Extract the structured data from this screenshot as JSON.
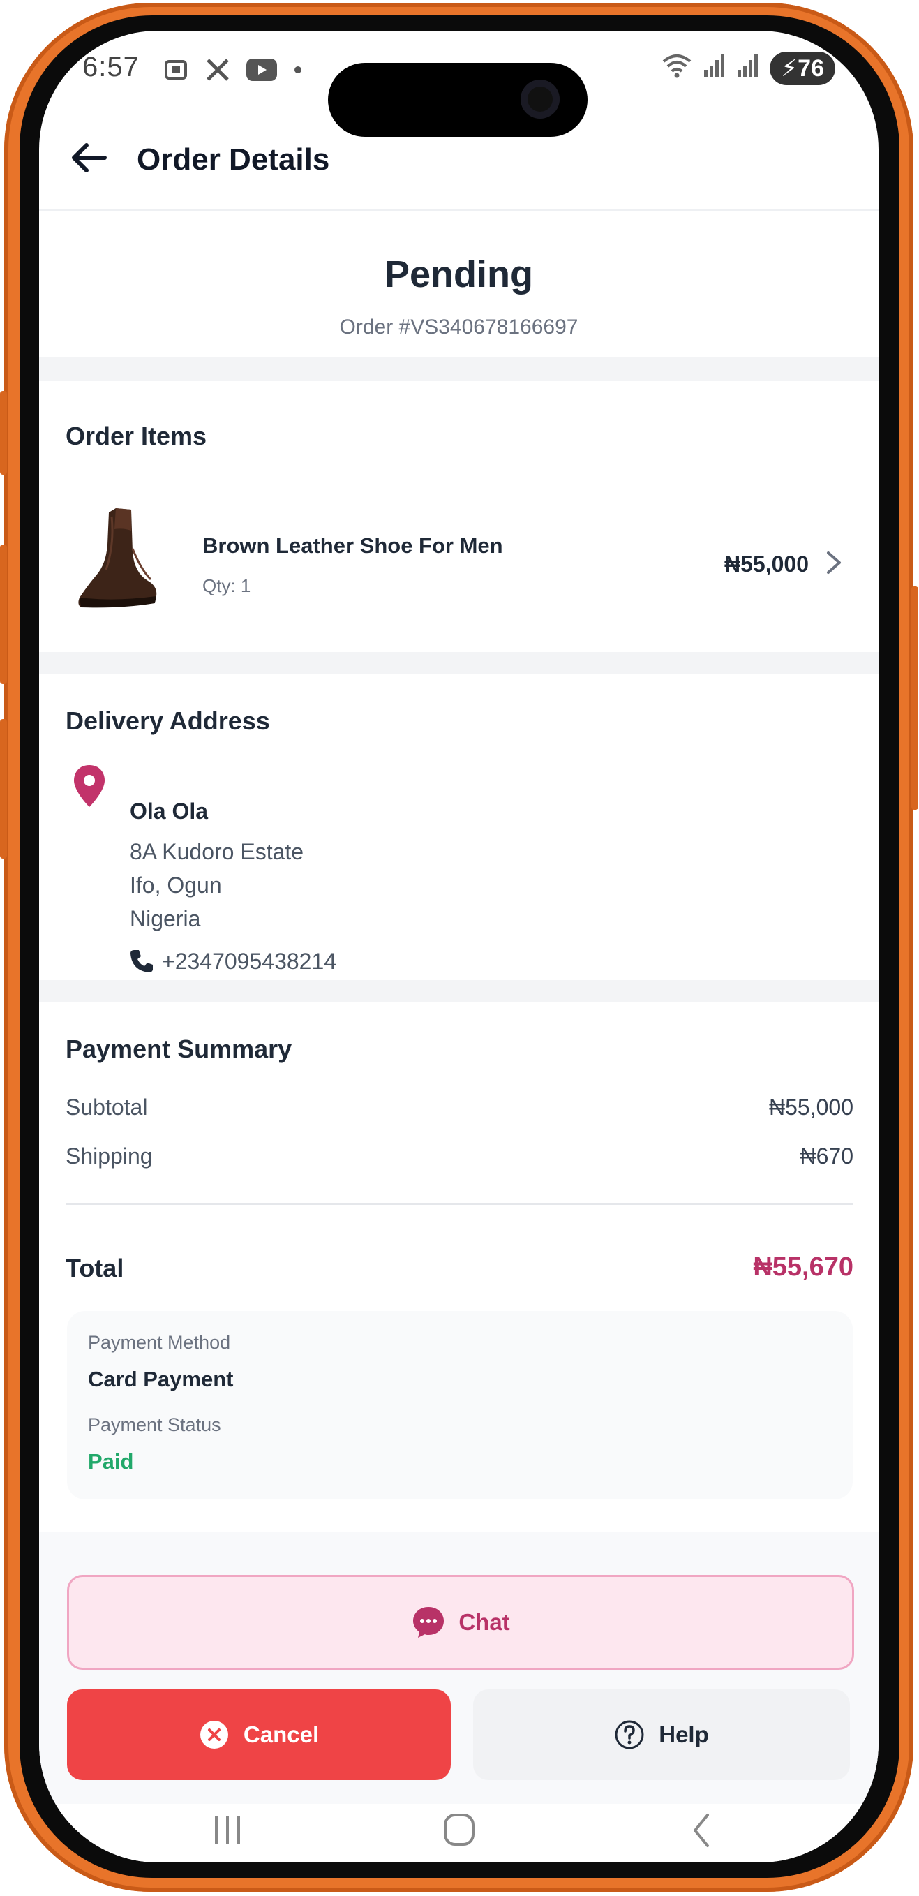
{
  "status_bar": {
    "time": "6:57",
    "left_icons": [
      "screenshot-icon",
      "x-icon",
      "youtube-icon",
      "dot-icon"
    ],
    "battery": "76"
  },
  "header": {
    "title": "Order Details"
  },
  "order": {
    "status": "Pending",
    "number": "Order #VS340678166697"
  },
  "order_items": {
    "title": "Order Items",
    "items": [
      {
        "name": "Brown Leather Shoe For Men",
        "qty": "Qty: 1",
        "price": "₦55,000"
      }
    ]
  },
  "delivery": {
    "title": "Delivery Address",
    "name": "Ola Ola",
    "lines": [
      "8A Kudoro Estate",
      "Ifo, Ogun",
      "Nigeria"
    ],
    "phone": "+2347095438214"
  },
  "payment": {
    "title": "Payment Summary",
    "subtotal_label": "Subtotal",
    "subtotal": "₦55,000",
    "shipping_label": "Shipping",
    "shipping": "₦670",
    "total_label": "Total",
    "total": "₦55,670",
    "method_label": "Payment Method",
    "method": "Card Payment",
    "status_label": "Payment Status",
    "status": "Paid"
  },
  "actions": {
    "chat": "Chat",
    "cancel": "Cancel",
    "help": "Help"
  },
  "colors": {
    "accent": "#b83267",
    "cancel": "#ef4446",
    "paid": "#22a86a",
    "frame": "#e8742a"
  }
}
